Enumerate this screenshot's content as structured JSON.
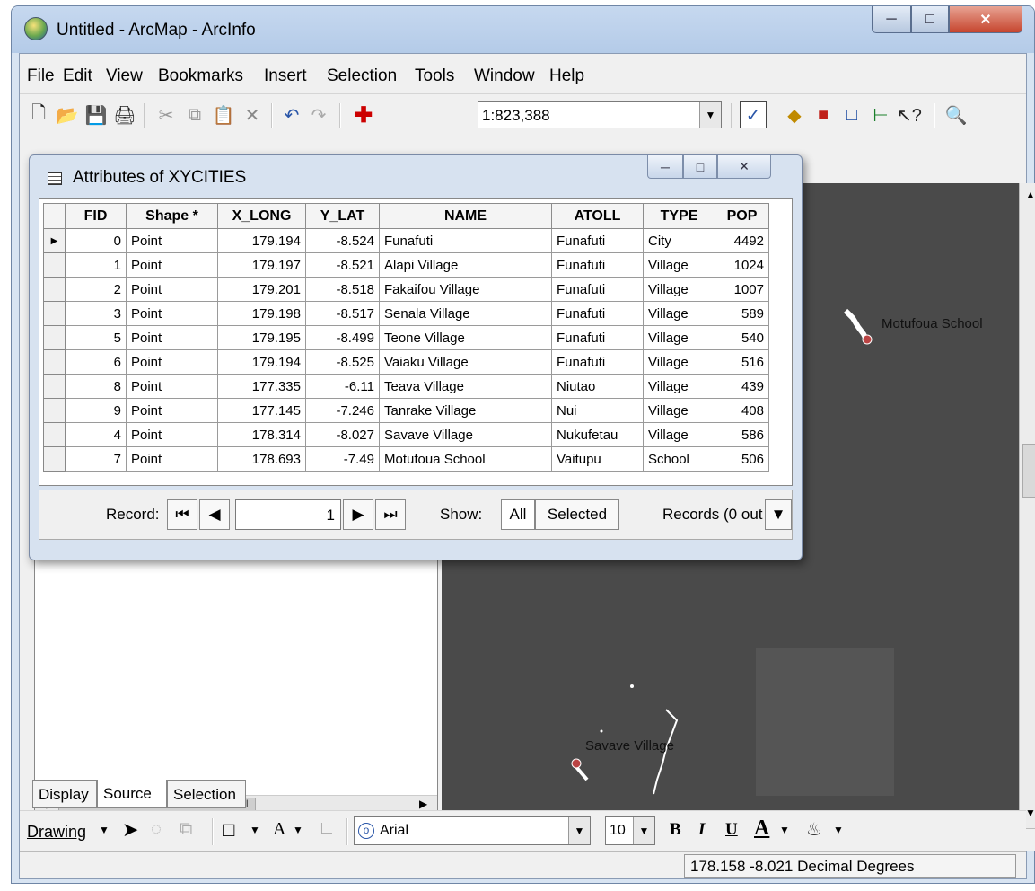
{
  "window": {
    "title": "Untitled - ArcMap - ArcInfo"
  },
  "menu": [
    "File",
    "Edit",
    "View",
    "Bookmarks",
    "Insert",
    "Selection",
    "Tools",
    "Window",
    "Help"
  ],
  "toolbar": {
    "scale": "1:823,388"
  },
  "toc": {
    "tabs": [
      "Display",
      "Source",
      "Selection"
    ],
    "scroll_glyph": "III"
  },
  "attributes": {
    "title": "Attributes of XYCITIES",
    "columns": [
      "FID",
      "Shape *",
      "X_LONG",
      "Y_LAT",
      "NAME",
      "ATOLL",
      "TYPE",
      "POP"
    ],
    "rows": [
      {
        "fid": "0",
        "shape": "Point",
        "x": "179.194",
        "y": "-8.524",
        "name": "Funafuti",
        "atoll": "Funafuti",
        "type": "City",
        "pop": "4492"
      },
      {
        "fid": "1",
        "shape": "Point",
        "x": "179.197",
        "y": "-8.521",
        "name": "Alapi Village",
        "atoll": "Funafuti",
        "type": "Village",
        "pop": "1024"
      },
      {
        "fid": "2",
        "shape": "Point",
        "x": "179.201",
        "y": "-8.518",
        "name": "Fakaifou Village",
        "atoll": "Funafuti",
        "type": "Village",
        "pop": "1007"
      },
      {
        "fid": "3",
        "shape": "Point",
        "x": "179.198",
        "y": "-8.517",
        "name": "Senala Village",
        "atoll": "Funafuti",
        "type": "Village",
        "pop": "589"
      },
      {
        "fid": "5",
        "shape": "Point",
        "x": "179.195",
        "y": "-8.499",
        "name": "Teone Village",
        "atoll": "Funafuti",
        "type": "Village",
        "pop": "540"
      },
      {
        "fid": "6",
        "shape": "Point",
        "x": "179.194",
        "y": "-8.525",
        "name": "Vaiaku Village",
        "atoll": "Funafuti",
        "type": "Village",
        "pop": "516"
      },
      {
        "fid": "8",
        "shape": "Point",
        "x": "177.335",
        "y": "-6.11",
        "name": "Teava Village",
        "atoll": "Niutao",
        "type": "Village",
        "pop": "439"
      },
      {
        "fid": "9",
        "shape": "Point",
        "x": "177.145",
        "y": "-7.246",
        "name": "Tanrake Village",
        "atoll": "Nui",
        "type": "Village",
        "pop": "408"
      },
      {
        "fid": "4",
        "shape": "Point",
        "x": "178.314",
        "y": "-8.027",
        "name": "Savave Village",
        "atoll": "Nukufetau",
        "type": "Village",
        "pop": "586"
      },
      {
        "fid": "7",
        "shape": "Point",
        "x": "178.693",
        "y": "-7.49",
        "name": "Motufoua School",
        "atoll": "Vaitupu",
        "type": "School",
        "pop": "506"
      }
    ],
    "footer": {
      "record_label": "Record:",
      "record_value": "1",
      "show_label": "Show:",
      "all": "All",
      "selected": "Selected",
      "records": "Records (0 out"
    }
  },
  "map": {
    "labels": {
      "motufoua": "Motufoua School",
      "savave": "Savave Village"
    }
  },
  "drawing": {
    "label": "Drawing",
    "font": "Arial",
    "size": "10",
    "bold": "B",
    "italic": "I",
    "underline": "U",
    "fontcolor": "A"
  },
  "status": {
    "coords": "178.158  -8.021 Decimal Degrees"
  },
  "colors": {
    "map_bg": "#4a4a4a",
    "titlebar": "#c6d8ef",
    "close": "#c6452e"
  }
}
